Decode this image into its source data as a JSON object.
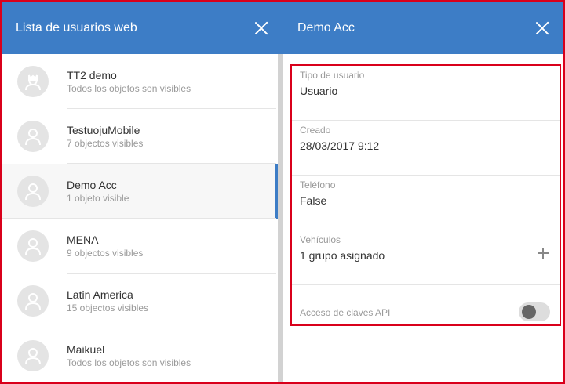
{
  "left_panel": {
    "title": "Lista de usuarios web",
    "items": [
      {
        "name": "TT2 demo",
        "sub": "Todos los objetos son visibles",
        "icon": "admin-avatar-icon",
        "selected": false
      },
      {
        "name": "TestuojuMobile",
        "sub": "7 objectos visibles",
        "icon": "user-avatar-icon",
        "selected": false
      },
      {
        "name": "Demo Acc",
        "sub": "1 objeto visible",
        "icon": "user-avatar-icon",
        "selected": true
      },
      {
        "name": "MENA",
        "sub": "9 objectos visibles",
        "icon": "user-avatar-icon",
        "selected": false
      },
      {
        "name": "Latin America",
        "sub": "15 objectos visibles",
        "icon": "user-avatar-icon",
        "selected": false
      },
      {
        "name": "Maikuel",
        "sub": "Todos los objetos son visibles",
        "icon": "user-avatar-icon",
        "selected": false
      }
    ]
  },
  "right_panel": {
    "title": "Demo Acc",
    "fields": {
      "user_type": {
        "label": "Tipo de usuario",
        "value": "Usuario"
      },
      "created": {
        "label": "Creado",
        "value": "28/03/2017 9:12"
      },
      "phone": {
        "label": "Teléfono",
        "value": "False"
      },
      "vehicles": {
        "label": "Vehículos",
        "value": "1 grupo asignado"
      },
      "api_keys": {
        "label": "Acceso de claves API",
        "enabled": false
      }
    }
  },
  "colors": {
    "header": "#3d7dc6",
    "highlight_border": "#d9001b",
    "selection_bar": "#3d7dc6"
  }
}
